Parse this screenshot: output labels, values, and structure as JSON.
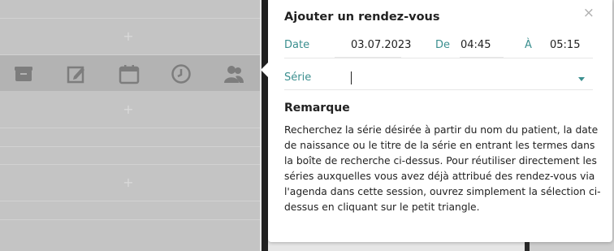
{
  "background": {
    "toolbar_icons": [
      "archive-icon",
      "edit-icon",
      "calendar-icon",
      "clock-icon",
      "users-icon"
    ],
    "add_slot_glyph": "+"
  },
  "popover": {
    "title": "Ajouter un rendez-vous",
    "close_glyph": "×",
    "date_label": "Date",
    "date_value": "03.07.2023",
    "from_label": "De",
    "from_value": "04:45",
    "to_label": "À",
    "to_value": "05:15",
    "serie_label": "Série",
    "serie_value": "",
    "remark_title": "Remarque",
    "remark_text": "Recherchez la série désirée à partir du nom du patient, la date de naissance ou le titre de la série en entrant les termes dans la boîte de recherche ci-dessus. Pour réutiliser directement les séries auxquelles vous avez déjà attribué des rendez-vous via l'agenda dans cette session, ouvrez simplement la sélection ci-dessus en cliquant sur le petit triangle."
  },
  "colors": {
    "accent": "#3b8f8f",
    "overlay": "#c4c4c4"
  }
}
